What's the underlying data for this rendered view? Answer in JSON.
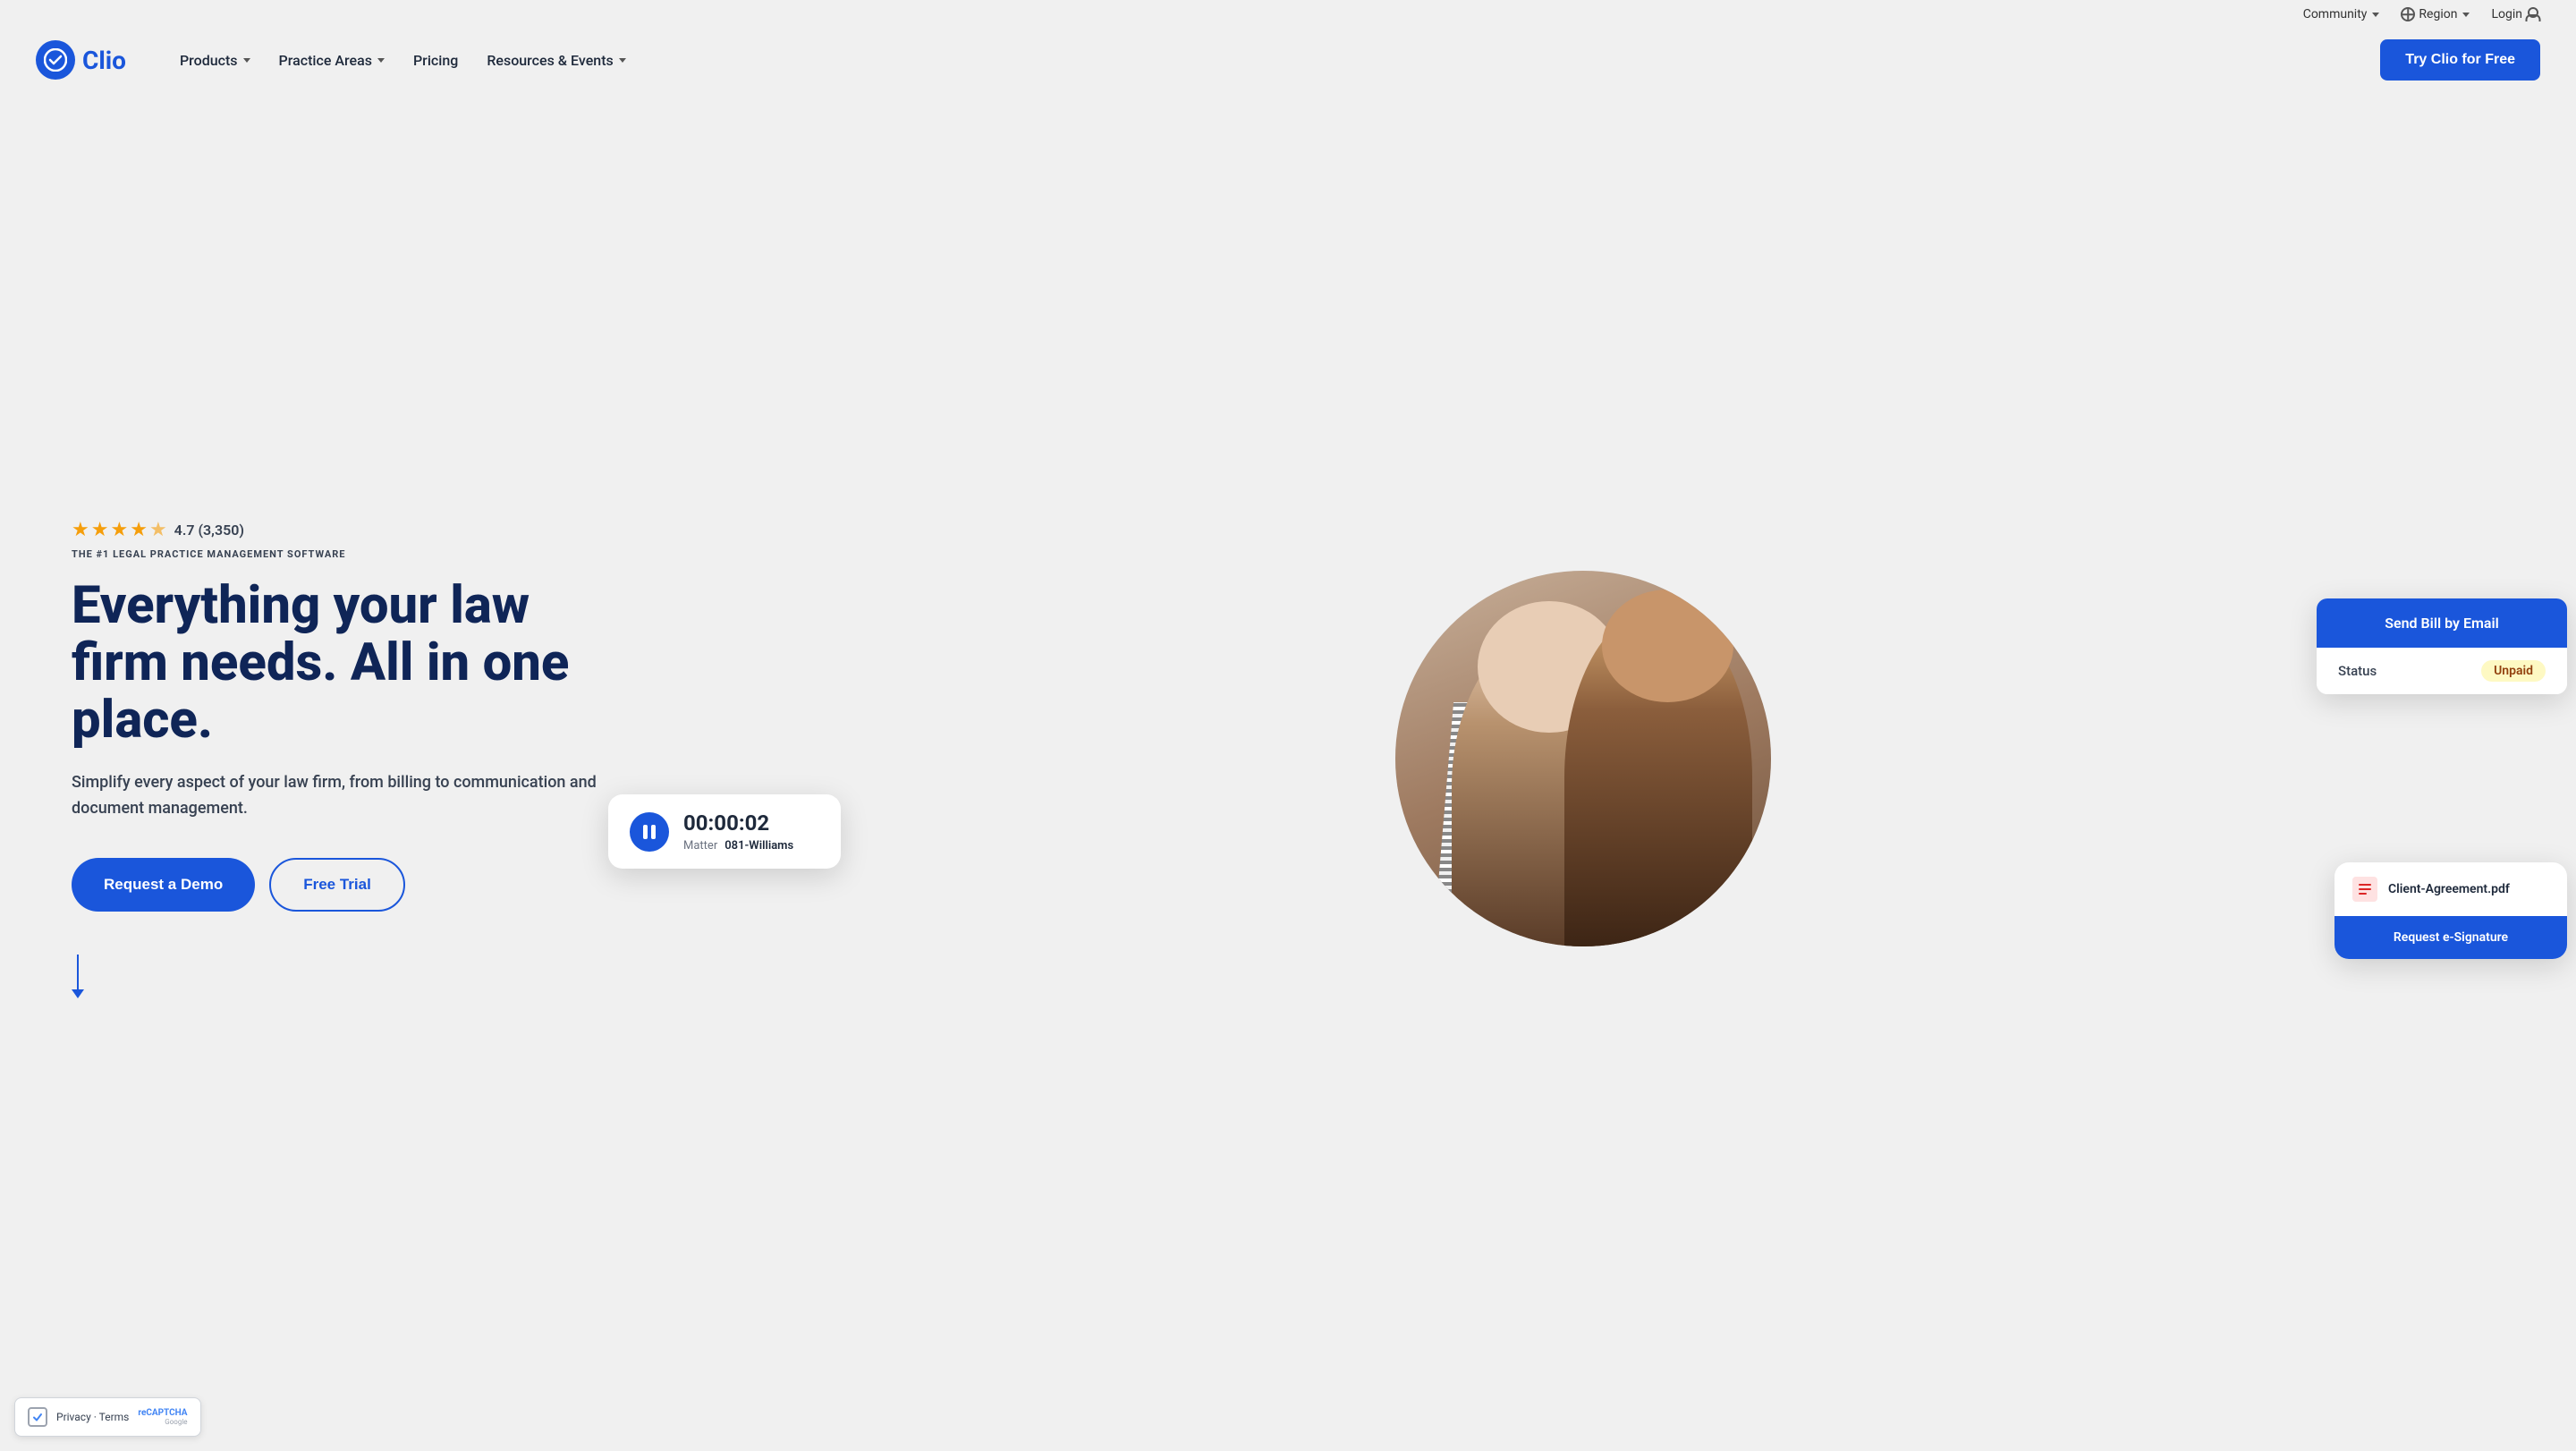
{
  "topBar": {
    "community": "Community",
    "region": "Region",
    "login": "Login"
  },
  "navbar": {
    "logo": "Clio",
    "products": "Products",
    "practiceAreas": "Practice Areas",
    "pricing": "Pricing",
    "resourcesEvents": "Resources & Events",
    "tryBtn": "Try Clio for Free"
  },
  "hero": {
    "rating": "4.7 (3,350)",
    "subtitle": "THE #1 LEGAL PRACTICE MANAGEMENT SOFTWARE",
    "title": "Everything your law firm needs. All in one place.",
    "description": "Simplify every aspect of your law firm, from billing to communication and document management.",
    "demoBtn": "Request a Demo",
    "trialBtn": "Free Trial"
  },
  "uiCards": {
    "timer": {
      "time": "00:00:02",
      "matterLabel": "Matter",
      "matterValue": "081-Williams"
    },
    "billing": {
      "sendBillBtn": "Send Bill by Email",
      "statusLabel": "Status",
      "unpaidBadge": "Unpaid"
    },
    "document": {
      "fileName": "Client-Agreement.pdf",
      "eSignBtn": "Request e-Signature"
    }
  },
  "recaptcha": {
    "label": "Privacy",
    "separator": "·",
    "terms": "Terms"
  }
}
